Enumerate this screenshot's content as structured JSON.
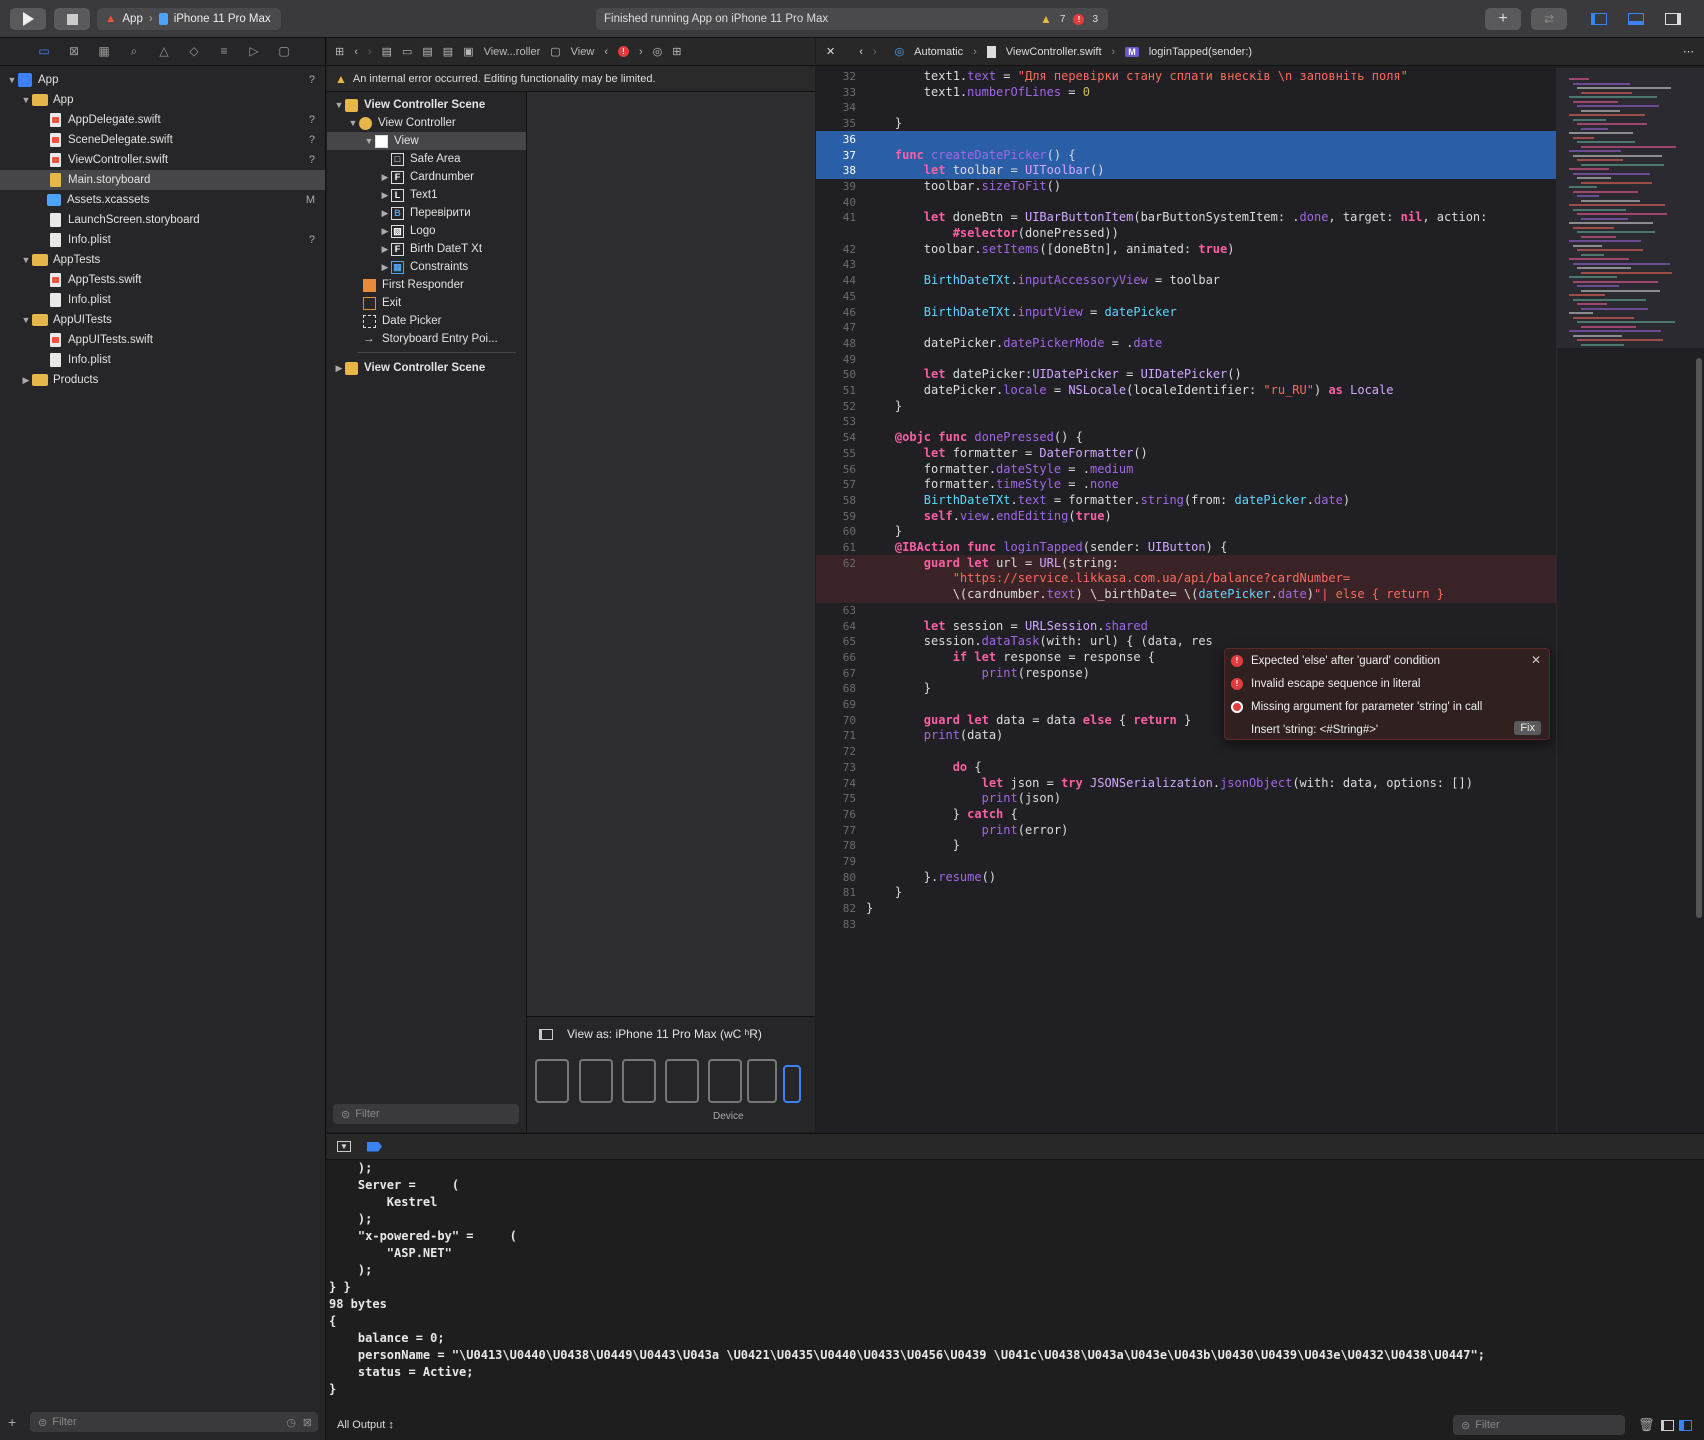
{
  "toolbar": {
    "scheme_app": "App",
    "scheme_device": "iPhone 11 Pro Max",
    "activity_text": "Finished running App on iPhone 11 Pro Max",
    "warnings": "7",
    "errors": "3"
  },
  "navigator": {
    "items": [
      {
        "label": "App",
        "status": "?"
      },
      {
        "label": "App",
        "status": ""
      },
      {
        "label": "AppDelegate.swift",
        "status": "?"
      },
      {
        "label": "SceneDelegate.swift",
        "status": "?"
      },
      {
        "label": "ViewController.swift",
        "status": "?"
      },
      {
        "label": "Main.storyboard",
        "status": ""
      },
      {
        "label": "Assets.xcassets",
        "status": "M"
      },
      {
        "label": "LaunchScreen.storyboard",
        "status": ""
      },
      {
        "label": "Info.plist",
        "status": "?"
      },
      {
        "label": "AppTests",
        "status": ""
      },
      {
        "label": "AppTests.swift",
        "status": ""
      },
      {
        "label": "Info.plist",
        "status": ""
      },
      {
        "label": "AppUITests",
        "status": ""
      },
      {
        "label": "AppUITests.swift",
        "status": ""
      },
      {
        "label": "Info.plist",
        "status": ""
      },
      {
        "label": "Products",
        "status": ""
      }
    ],
    "filter_placeholder": "Filter"
  },
  "ib": {
    "jump": [
      "View...roller",
      "View"
    ],
    "error_banner": "An internal error occurred. Editing functionality may be limited.",
    "outline": [
      {
        "label": "View Controller Scene",
        "icon": ""
      },
      {
        "label": "View Controller",
        "icon": ""
      },
      {
        "label": "View",
        "icon": ""
      },
      {
        "label": "Safe Area",
        "icon": "□"
      },
      {
        "label": "Cardnumber",
        "icon": "F"
      },
      {
        "label": "Text1",
        "icon": "L"
      },
      {
        "label": "Перевірити",
        "icon": "B"
      },
      {
        "label": "Logo",
        "icon": "▨"
      },
      {
        "label": "Birth DateT Xt",
        "icon": "F"
      },
      {
        "label": "Constraints",
        "icon": "▦"
      },
      {
        "label": "First Responder",
        "icon": ""
      },
      {
        "label": "Exit",
        "icon": ""
      },
      {
        "label": "Date Picker",
        "icon": ""
      },
      {
        "label": "Storyboard Entry Poi...",
        "icon": ""
      },
      {
        "label": "View Controller Scene",
        "icon": ""
      }
    ],
    "view_as": "View as: iPhone 11 Pro Max (ᴡC ʰR)",
    "device_label": "Device",
    "filter_placeholder": "Filter"
  },
  "editor": {
    "jump": [
      "Automatic",
      "ViewController.swift",
      "loginTapped(sender:)"
    ],
    "lines": [
      {
        "n": "32",
        "t": "        text1.text = \"Для перевірки стану сплати внесків \\n заповніть поля\""
      },
      {
        "n": "33",
        "t": "        text1.numberOfLines = 0"
      },
      {
        "n": "34",
        "t": ""
      },
      {
        "n": "35",
        "t": "    }"
      },
      {
        "n": "36",
        "t": ""
      },
      {
        "n": "37",
        "t": "    func createDatePicker() {"
      },
      {
        "n": "38",
        "t": "        let toolbar = UIToolbar()"
      },
      {
        "n": "39",
        "t": "        toolbar.sizeToFit()"
      },
      {
        "n": "40",
        "t": ""
      },
      {
        "n": "41",
        "t": "        let doneBtn = UIBarButtonItem(barButtonSystemItem: .done, target: nil, action:"
      },
      {
        "n": "",
        "t": "            #selector(donePressed))"
      },
      {
        "n": "42",
        "t": "        toolbar.setItems([doneBtn], animated: true)"
      },
      {
        "n": "43",
        "t": ""
      },
      {
        "n": "44",
        "t": "        BirthDateTXt.inputAccessoryView = toolbar"
      },
      {
        "n": "45",
        "t": ""
      },
      {
        "n": "46",
        "t": "        BirthDateTXt.inputView = datePicker"
      },
      {
        "n": "47",
        "t": ""
      },
      {
        "n": "48",
        "t": "        datePicker.datePickerMode = .date"
      },
      {
        "n": "49",
        "t": ""
      },
      {
        "n": "50",
        "t": "        let datePicker:UIDatePicker = UIDatePicker()"
      },
      {
        "n": "51",
        "t": "        datePicker.locale = NSLocale(localeIdentifier: \"ru_RU\") as Locale"
      },
      {
        "n": "52",
        "t": "    }"
      },
      {
        "n": "53",
        "t": ""
      },
      {
        "n": "54",
        "t": "    @objc func donePressed() {"
      },
      {
        "n": "55",
        "t": "        let formatter = DateFormatter()"
      },
      {
        "n": "56",
        "t": "        formatter.dateStyle = .medium"
      },
      {
        "n": "57",
        "t": "        formatter.timeStyle = .none"
      },
      {
        "n": "58",
        "t": "        BirthDateTXt.text = formatter.string(from: datePicker.date)"
      },
      {
        "n": "59",
        "t": "        self.view.endEditing(true)"
      },
      {
        "n": "60",
        "t": "    }"
      },
      {
        "n": "61",
        "t": "    @IBAction func loginTapped(sender: UIButton) {"
      },
      {
        "n": "62",
        "t": "        guard let url = URL(string:"
      },
      {
        "n": "",
        "t": "            \"https://service.likkasa.com.ua/api/balance?cardNumber="
      },
      {
        "n": "",
        "t": "            \\(cardnumber.text) \\_birthDate= \\(datePicker.date)\"| else { return }"
      },
      {
        "n": "63",
        "t": ""
      },
      {
        "n": "64",
        "t": "        let session = URLSession.shared"
      },
      {
        "n": "65",
        "t": "        session.dataTask(with: url) { (data, res"
      },
      {
        "n": "66",
        "t": "            if let response = response {"
      },
      {
        "n": "67",
        "t": "                print(response)"
      },
      {
        "n": "68",
        "t": "        }"
      },
      {
        "n": "69",
        "t": ""
      },
      {
        "n": "70",
        "t": "        guard let data = data else { return }"
      },
      {
        "n": "71",
        "t": "        print(data)"
      },
      {
        "n": "72",
        "t": ""
      },
      {
        "n": "73",
        "t": "            do {"
      },
      {
        "n": "74",
        "t": "                let json = try JSONSerialization.jsonObject(with: data, options: [])"
      },
      {
        "n": "75",
        "t": "                print(json)"
      },
      {
        "n": "76",
        "t": "            } catch {"
      },
      {
        "n": "77",
        "t": "                print(error)"
      },
      {
        "n": "78",
        "t": "            }"
      },
      {
        "n": "79",
        "t": ""
      },
      {
        "n": "80",
        "t": "        }.resume()"
      },
      {
        "n": "81",
        "t": "    }"
      },
      {
        "n": "82",
        "t": "}"
      },
      {
        "n": "83",
        "t": ""
      }
    ],
    "errors": [
      "Expected 'else' after 'guard' condition",
      "Invalid escape sequence in literal",
      "Missing argument for parameter 'string' in call",
      "Insert 'string: <#String#>'"
    ],
    "fix_label": "Fix"
  },
  "debug": {
    "console": [
      "    );",
      "    Server =     (",
      "        Kestrel",
      "    );",
      "    \"x-powered-by\" =     (",
      "        \"ASP.NET\"",
      "    );",
      "} }",
      "98 bytes",
      "{",
      "    balance = 0;",
      "    personName = \"\\U0413\\U0440\\U0438\\U0449\\U0443\\U043a \\U0421\\U0435\\U0440\\U0433\\U0456\\U0439 \\U041c\\U0438\\U043a\\U043e\\U043b\\U0430\\U0439\\U043e\\U0432\\U0438\\U0447\";",
      "    status = Active;",
      "}"
    ],
    "output_selector": "All Output ↕",
    "filter_placeholder": "Filter"
  }
}
